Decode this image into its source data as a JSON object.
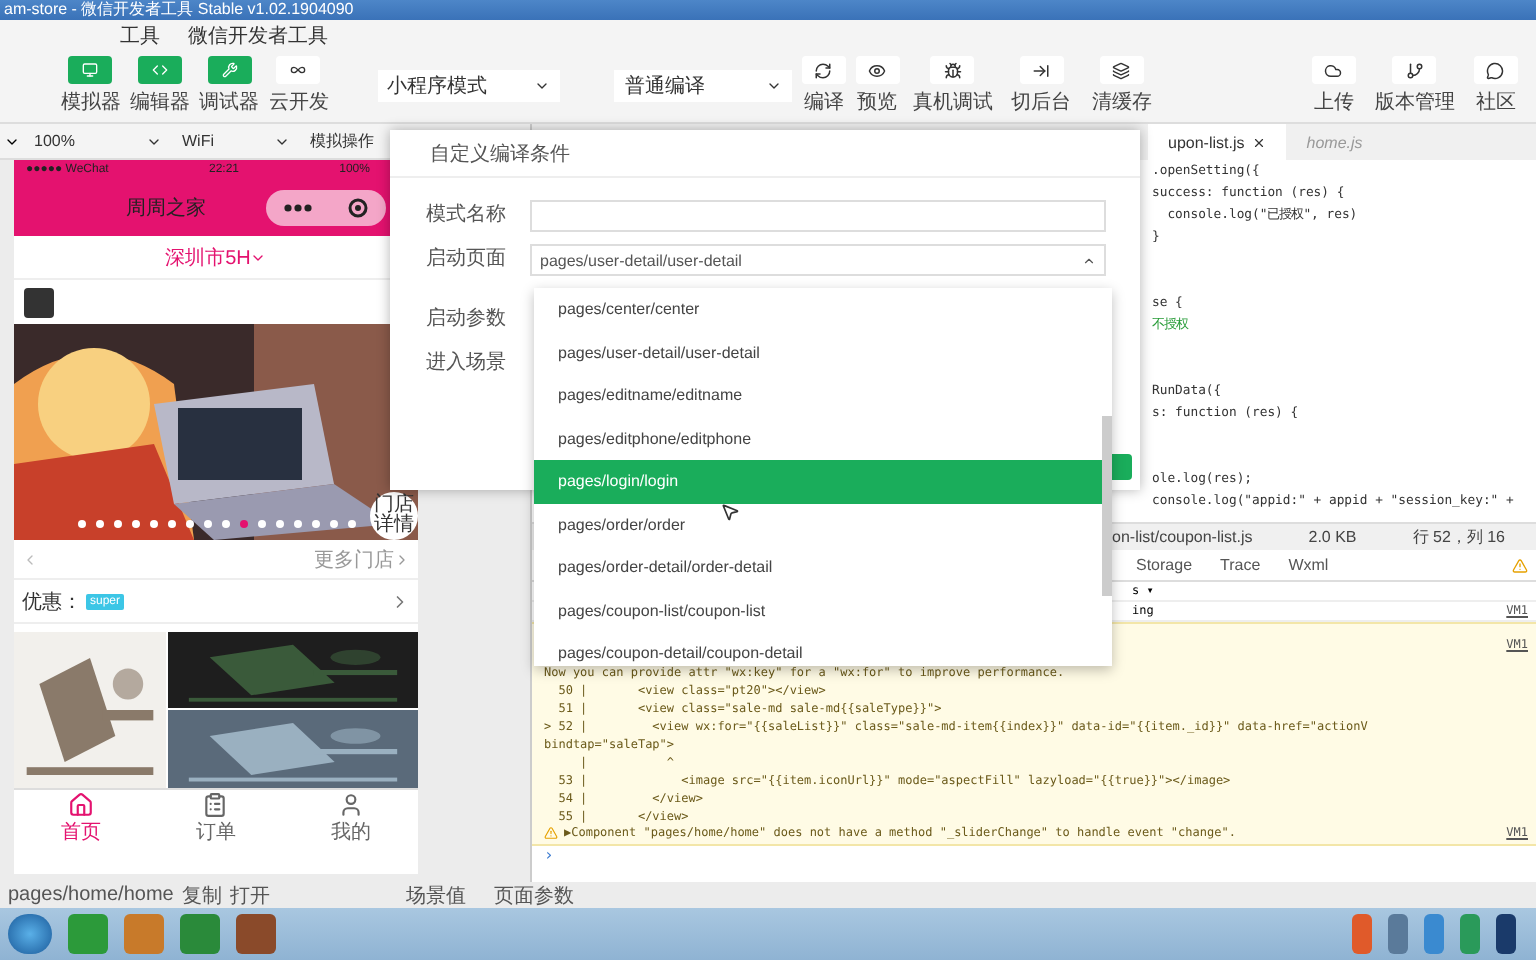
{
  "window": {
    "title": "am-store - 微信开发者工具 Stable v1.02.1904090"
  },
  "menu": [
    "工具",
    "微信开发者工具"
  ],
  "toolbar": {
    "views": [
      {
        "label": "模拟器",
        "selected": true
      },
      {
        "label": "编辑器",
        "selected": true
      },
      {
        "label": "调试器",
        "selected": true
      },
      {
        "label": "云开发",
        "selected": false
      }
    ],
    "mode_select": "小程序模式",
    "compile_select": "普通编译",
    "actions": [
      "编译",
      "预览",
      "真机调试",
      "切后台",
      "清缓存"
    ],
    "right_actions": [
      "上传",
      "版本管理",
      "社区"
    ]
  },
  "simulator": {
    "zoom": "100%",
    "network": "WiFi",
    "operation": "模拟操作",
    "phone": {
      "carrier": "●●●●● WeChat",
      "time": "22:21",
      "battery": "100%",
      "title": "周周之家",
      "location": "深圳市5H",
      "store_button": "门店详情",
      "more": "更多门店",
      "coupon_label": "优惠：",
      "coupon_tag": "super",
      "tabs": [
        {
          "label": "首页",
          "selected": true
        },
        {
          "label": "订单",
          "selected": false
        },
        {
          "label": "我的",
          "selected": false
        }
      ]
    }
  },
  "editor": {
    "tabs": [
      {
        "label": "upon-list.js",
        "selected": true
      },
      {
        "label": "home.js",
        "selected": false
      }
    ],
    "lines": [
      {
        "text": ".openSetting({"
      },
      {
        "text": "success: function (res) {"
      },
      {
        "text": "  console.log(\"已授权\", res)"
      },
      {
        "text": "}"
      },
      {
        "text": "se {",
        "gap": true
      },
      {
        "text": "不授权",
        "kind": "comment"
      },
      {
        "text": "RunData({",
        "gap": true
      },
      {
        "text": "s: function (res) {"
      },
      {
        "text": "ole.log(res);",
        "gap": true
      },
      {
        "text": "console.log(\"appid:\" + appid + \"session_key:\" +"
      }
    ],
    "file": "on-list/coupon-list.js",
    "size": "2.0 KB",
    "cursor": "行 52，列 16"
  },
  "devtools": {
    "tabs": [
      "Storage",
      "Trace",
      "Wxml"
    ],
    "filter": "s ▾",
    "top_line": "ing",
    "link": "VM1",
    "warning_link": "VM1",
    "message_link": "VM1",
    "warning_lines": [
      "Now you can provide attr \"wx:key\" for a \"wx:for\" to improve performance.",
      "  50 |       <view class=\"pt20\"></view>",
      "  51 |       <view class=\"sale-md sale-md{{saleType}}\">",
      "> 52 |         <view wx:for=\"{{saleList}}\" class=\"sale-md-item{{index}}\" data-id=\"{{item._id}}\" data-href=\"actionV",
      "bindtap=\"saleTap\">",
      "     |           ^",
      "  53 |             <image src=\"{{item.iconUrl}}\" mode=\"aspectFill\" lazyload=\"{{true}}\"></image>",
      "  54 |         </view>",
      "  55 |       </view>"
    ],
    "message": "▶Component \"pages/home/home\" does not have a method \"_sliderChange\" to handle event \"change\".",
    "prompt": "›"
  },
  "status_bar": {
    "path": "pages/home/home",
    "links": [
      "复制",
      "打开"
    ],
    "right": [
      "场景值",
      "页面参数"
    ]
  },
  "dialog": {
    "title": "自定义编译条件",
    "labels": [
      "模式名称",
      "启动页面",
      "启动参数",
      "进入场景"
    ],
    "start_page": "pages/user-detail/user-detail",
    "options": [
      {
        "label": "pages/center/center",
        "selected": false
      },
      {
        "label": "pages/user-detail/user-detail",
        "selected": false
      },
      {
        "label": "pages/editname/editname",
        "selected": false
      },
      {
        "label": "pages/editphone/editphone",
        "selected": false
      },
      {
        "label": "pages/login/login",
        "selected": true
      },
      {
        "label": "pages/order/order",
        "selected": false
      },
      {
        "label": "pages/order-detail/order-detail",
        "selected": false
      },
      {
        "label": "pages/coupon-list/coupon-list",
        "selected": false
      },
      {
        "label": "pages/coupon-detail/coupon-detail",
        "selected": false
      }
    ]
  }
}
